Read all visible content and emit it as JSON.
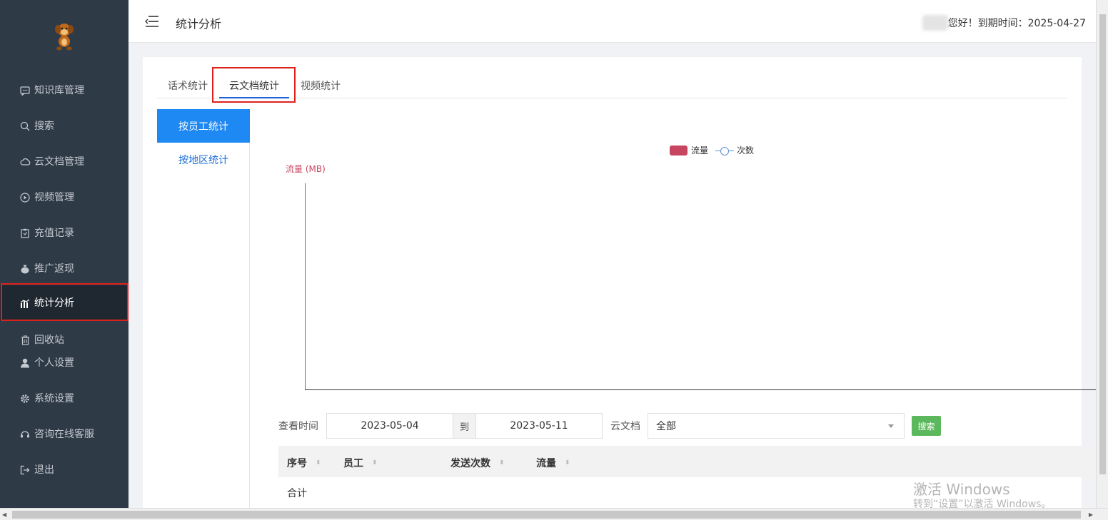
{
  "sidebar": {
    "items": [
      {
        "label": "知识库管理",
        "icon": "message-icon",
        "active": false
      },
      {
        "label": "搜索",
        "icon": "search-icon",
        "active": false
      },
      {
        "label": "云文档管理",
        "icon": "cloud-icon",
        "active": false
      },
      {
        "label": "视频管理",
        "icon": "play-icon",
        "active": false
      },
      {
        "label": "充值记录",
        "icon": "clipboard-icon",
        "active": false
      },
      {
        "label": "推广返现",
        "icon": "money-bag-icon",
        "active": false
      },
      {
        "label": "统计分析",
        "icon": "chart-icon",
        "active": true
      },
      {
        "label": "回收站",
        "icon": "trash-icon",
        "active": false
      },
      {
        "label": "个人设置",
        "icon": "user-icon",
        "active": false
      },
      {
        "label": "系统设置",
        "icon": "gear-icon",
        "active": false
      },
      {
        "label": "咨询在线客服",
        "icon": "headset-icon",
        "active": false
      },
      {
        "label": "退出",
        "icon": "logout-icon",
        "active": false
      }
    ]
  },
  "header": {
    "title": "统计分析",
    "greeting": "您好！到期时间：2025-04-27"
  },
  "tabs": [
    {
      "label": "话术统计",
      "active": false
    },
    {
      "label": "云文档统计",
      "active": true
    },
    {
      "label": "视频统计",
      "active": false
    }
  ],
  "side_tabs": [
    {
      "label": "按员工统计",
      "active": true
    },
    {
      "label": "按地区统计",
      "active": false
    }
  ],
  "chart_data": {
    "type": "bar",
    "categories": [],
    "series": [
      {
        "name": "流量",
        "type": "bar",
        "values": []
      },
      {
        "name": "次数",
        "type": "line",
        "values": []
      }
    ],
    "ylabel": "流量 (MB)",
    "legend_position": "top-center",
    "colors": {
      "bar": "#c8455f",
      "line": "#5a8fd6"
    }
  },
  "filter": {
    "time_label": "查看时间",
    "start_date": "2023-05-04",
    "separator": "到",
    "end_date": "2023-05-11",
    "doc_label": "云文档",
    "doc_value": "全部",
    "search_button": "搜索"
  },
  "table": {
    "columns": [
      "序号",
      "员工",
      "发送次数",
      "流量"
    ],
    "rows": [],
    "footer": "合计"
  },
  "watermark": {
    "line1": "激活 Windows",
    "line2": "转到“设置”以激活 Windows。"
  },
  "colors": {
    "sidebar_bg": "#2f3a47",
    "accent": "#1e88f3",
    "highlight": "#e0201b",
    "search_button": "#5cb85c"
  }
}
